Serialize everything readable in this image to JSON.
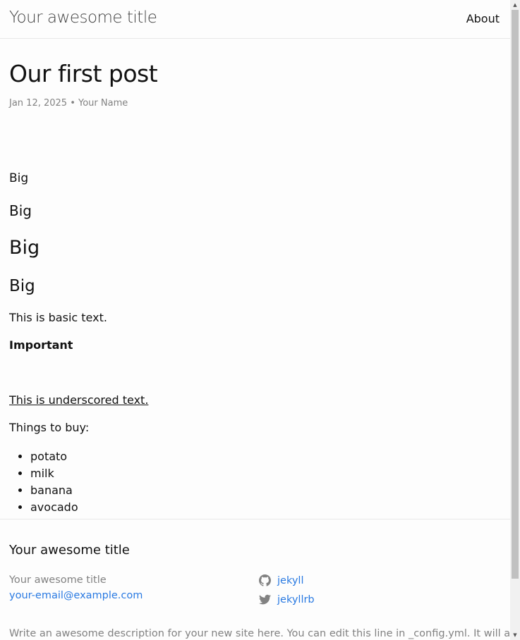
{
  "header": {
    "site_title": "Your awesome title",
    "nav_about": "About"
  },
  "post": {
    "title": "Our first post",
    "meta": "Jan 12, 2025 • Your Name",
    "headings": [
      "Big",
      "Big",
      "Big",
      "Big"
    ],
    "basic_text": "This is basic text.",
    "important": "Important",
    "underscored": "This is underscored text.",
    "things_label": "Things to buy:",
    "list": [
      "potato",
      "milk",
      "banana",
      "avocado"
    ]
  },
  "footer": {
    "heading": "Your awesome title",
    "name": "Your awesome title",
    "email": "your-email@example.com",
    "social": [
      {
        "label": "jekyll",
        "icon": "github-icon"
      },
      {
        "label": "jekyllrb",
        "icon": "twitter-icon"
      }
    ],
    "description": "Write an awesome description for your new site here. You can edit this line in _config.yml. It will appear"
  },
  "colors": {
    "link": "#2a7ae2",
    "muted": "#828282",
    "text": "#111111",
    "background": "#fdfdfd"
  }
}
